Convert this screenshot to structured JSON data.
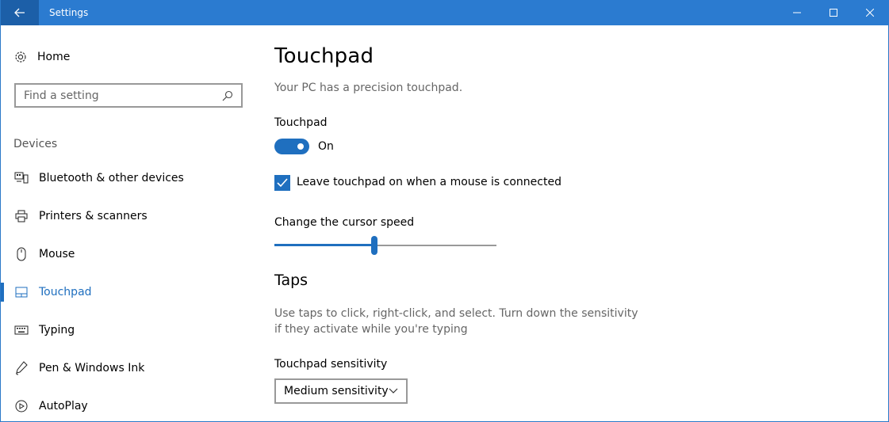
{
  "window": {
    "title": "Settings"
  },
  "sidebar": {
    "home_label": "Home",
    "search_placeholder": "Find a setting",
    "section_label": "Devices",
    "items": [
      {
        "label": "Bluetooth & other devices",
        "icon": "bluetooth-devices-icon"
      },
      {
        "label": "Printers & scanners",
        "icon": "printer-icon"
      },
      {
        "label": "Mouse",
        "icon": "mouse-icon"
      },
      {
        "label": "Touchpad",
        "icon": "touchpad-icon",
        "active": true
      },
      {
        "label": "Typing",
        "icon": "keyboard-icon"
      },
      {
        "label": "Pen & Windows Ink",
        "icon": "pen-icon"
      },
      {
        "label": "AutoPlay",
        "icon": "autoplay-icon"
      }
    ]
  },
  "main": {
    "title": "Touchpad",
    "subtitle": "Your PC has a precision touchpad.",
    "touchpad_label": "Touchpad",
    "toggle_state": "On",
    "toggle_on": true,
    "checkbox_label": "Leave touchpad on when a mouse is connected",
    "checkbox_checked": true,
    "cursor_speed_label": "Change the cursor speed",
    "cursor_speed_fraction": 0.45,
    "taps_title": "Taps",
    "taps_description": "Use taps to click, right-click, and select. Turn down the sensitivity if they activate while you're typing",
    "sensitivity_label": "Touchpad sensitivity",
    "sensitivity_value": "Medium sensitivity"
  },
  "colors": {
    "accent": "#1f6fbf",
    "titlebar": "#2b7bd0"
  }
}
